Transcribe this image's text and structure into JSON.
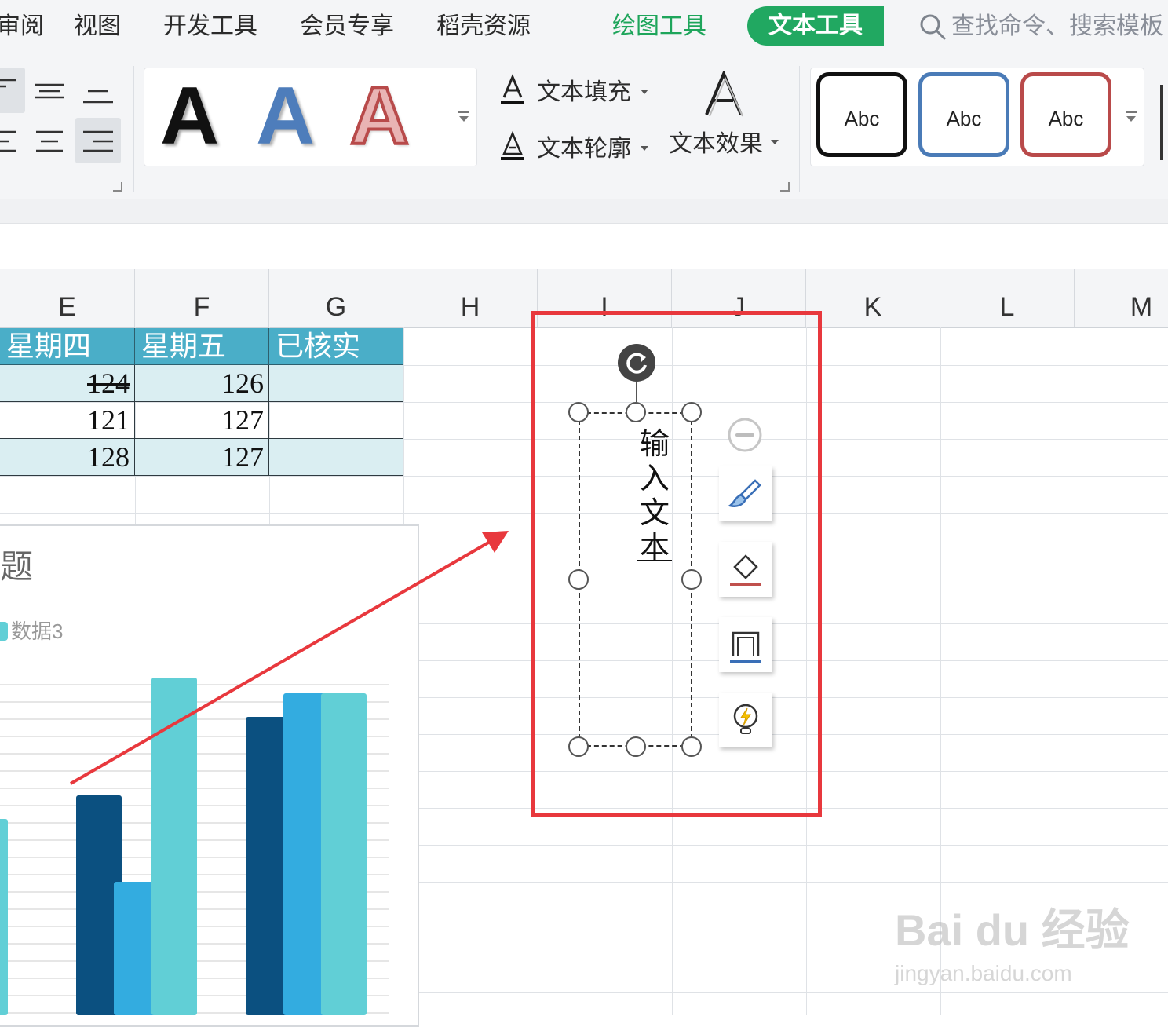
{
  "menu": {
    "items": [
      "审阅",
      "视图",
      "开发工具",
      "会员专享",
      "稻壳资源"
    ],
    "drawing_tools": "绘图工具",
    "text_tools": "文本工具",
    "search_placeholder": "查找命令、搜索模板"
  },
  "ribbon": {
    "wordart_letters": [
      "A",
      "A",
      "A"
    ],
    "text_fill": "文本填充",
    "text_outline": "文本轮廓",
    "text_effects": "文本效果",
    "shape_styles": [
      "Abc",
      "Abc",
      "Abc"
    ],
    "colors": {
      "green": "#21a861",
      "wordart_blue": "#4e7dbb",
      "wordart_red": "#b84a4a",
      "style_blue": "#4a7bb7",
      "style_red": "#b94a4a"
    }
  },
  "sheet": {
    "columns": [
      "E",
      "F",
      "G",
      "H",
      "I",
      "J",
      "K",
      "L",
      "M"
    ],
    "table": {
      "headers": [
        "星期四",
        "星期五",
        "已核实"
      ],
      "rows": [
        [
          "124",
          "126",
          ""
        ],
        [
          "121",
          "127",
          ""
        ],
        [
          "128",
          "127",
          ""
        ]
      ],
      "header_color": "#4aaec8",
      "band_color": "#daeef2"
    }
  },
  "chart": {
    "title_fragment": "题",
    "legend_label": "数据3",
    "colors": {
      "series1": "#0b5080",
      "series2": "#33ace0",
      "series3": "#61cfd6"
    }
  },
  "chart_data": {
    "type": "bar",
    "title": "",
    "series": [
      {
        "name": "",
        "values": [
          null,
          280,
          380
        ]
      },
      {
        "name": "",
        "values": [
          null,
          170,
          410
        ]
      },
      {
        "name": "数据3",
        "values": [
          250,
          430,
          410
        ]
      }
    ],
    "categories": [
      "",
      "",
      ""
    ],
    "note_visible": "partial chart, cropped at left/bottom"
  },
  "textbox": {
    "vertical_text": [
      "输",
      "入",
      "文",
      "本"
    ]
  },
  "watermark": {
    "logo": "Bai du 经验",
    "url": "jingyan.baidu.com"
  }
}
